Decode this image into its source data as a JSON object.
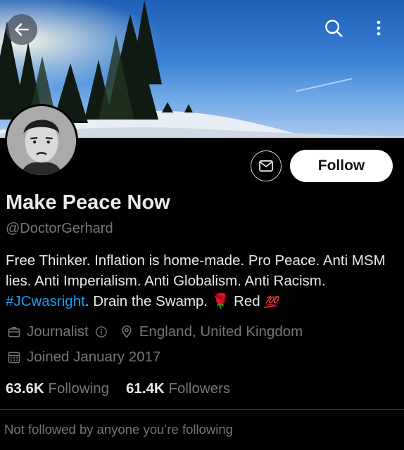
{
  "header": {
    "back_icon": "arrow-left-icon",
    "search_icon": "search-icon",
    "more_icon": "more-vertical-icon"
  },
  "profile": {
    "display_name": "Make Peace Now",
    "handle": "@DoctorGerhard",
    "follow_label": "Follow",
    "message_icon": "mail-icon",
    "bio": {
      "text1": "Free Thinker. Inflation is home-made. Pro Peace. Anti MSM lies. Anti Imperialism. Anti Globalism. Anti Racism. ",
      "hashtag": "#JCwasright",
      "text2": ". Drain the Swamp. ",
      "rose_emoji": "🌹",
      "text3": " Red ",
      "hundred_emoji": "💯"
    },
    "profession": "Journalist",
    "location": "England, United Kingdom",
    "joined": "Joined January 2017",
    "following_count": "63.6K",
    "following_label": "Following",
    "followers_count": "61.4K",
    "followers_label": "Followers",
    "not_followed_text": "Not followed by anyone you’re following"
  },
  "colors": {
    "background": "#000000",
    "text_primary": "#e7e9ea",
    "text_secondary": "#71767b",
    "link": "#1d9bf0"
  }
}
